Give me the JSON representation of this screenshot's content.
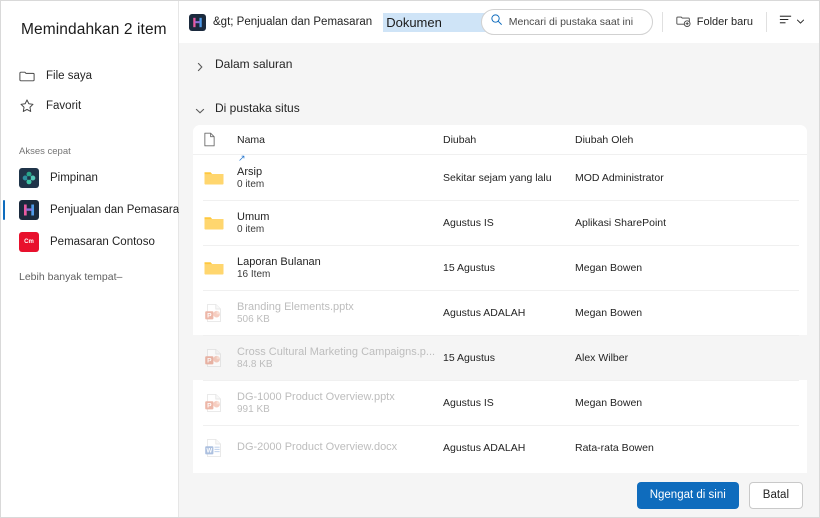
{
  "dialog": {
    "title": "Memindahkan 2 item"
  },
  "sidebar": {
    "nav": [
      {
        "label": "File saya",
        "icon": "folder-icon"
      },
      {
        "label": "Favorit",
        "icon": "star-icon"
      }
    ],
    "quick_access_label": "Akses cepat",
    "sites": [
      {
        "label": "Pimpinan",
        "icon": "leadership-site-icon",
        "selected": false
      },
      {
        "label": "Penjualan dan Pemasaran",
        "icon": "sales-marketing-site-icon",
        "selected": true
      },
      {
        "label": "Pemasaran Contoso",
        "icon": "contoso-marketing-site-icon",
        "badge": "Cm",
        "selected": false
      }
    ],
    "more_places": "Lebih banyak tempat–"
  },
  "topbar": {
    "breadcrumb_prefix": "&gt; Penjualan dan Pemasaran",
    "breadcrumb_current": "Dokumen",
    "search_placeholder": "Mencari di pustaka saat ini",
    "new_folder_label": "Folder baru"
  },
  "tree": {
    "sections": [
      {
        "label": "Dalam saluran",
        "expanded": false
      },
      {
        "label": "Di pustaka situs",
        "expanded": true
      }
    ]
  },
  "table": {
    "columns": {
      "name": "Nama",
      "modified": "Diubah",
      "modified_by": "Diubah Oleh"
    },
    "rows": [
      {
        "name": "Arsip",
        "meta": "0 item",
        "modified": "Sekitar sejam yang lalu",
        "modified_by": "MOD Administrator",
        "type": "folder",
        "disabled": false,
        "hovered": false,
        "shortcut": true
      },
      {
        "name": "Umum",
        "meta": "0 item",
        "modified": "Agustus IS",
        "modified_by": "Aplikasi SharePoint",
        "type": "folder",
        "disabled": false,
        "hovered": false,
        "shortcut": false
      },
      {
        "name": "Laporan Bulanan",
        "meta": "16 Item",
        "modified": "15 Agustus",
        "modified_by": "Megan Bowen",
        "type": "folder",
        "disabled": false,
        "hovered": false,
        "shortcut": false
      },
      {
        "name": "Branding Elements.pptx",
        "meta": "506 KB",
        "modified": "Agustus  ADALAH",
        "modified_by": "Megan Bowen",
        "type": "powerpoint",
        "disabled": true,
        "hovered": false,
        "shortcut": false
      },
      {
        "name": "Cross Cultural Marketing Campaigns.p...",
        "meta": "84.8 KB",
        "modified": "15 Agustus",
        "modified_by": "Alex Wilber",
        "type": "powerpoint",
        "disabled": true,
        "hovered": true,
        "shortcut": false
      },
      {
        "name": "DG-1000 Product Overview.pptx",
        "meta": "991 KB",
        "modified": "Agustus IS",
        "modified_by": "Megan Bowen",
        "type": "powerpoint",
        "disabled": true,
        "hovered": false,
        "shortcut": false
      },
      {
        "name": "DG-2000 Product Overview.docx",
        "meta": "",
        "modified": "Agustus   ADALAH",
        "modified_by": "Rata-rata Bowen",
        "type": "word",
        "disabled": true,
        "hovered": false,
        "shortcut": false
      }
    ]
  },
  "footer": {
    "primary": "Ngengat di sini",
    "secondary": "Batal"
  },
  "colors": {
    "accent": "#0f6cbd",
    "selection_highlight": "#cfe4f7",
    "folder": "#ffc83d",
    "contoso_red": "#e8112d"
  }
}
